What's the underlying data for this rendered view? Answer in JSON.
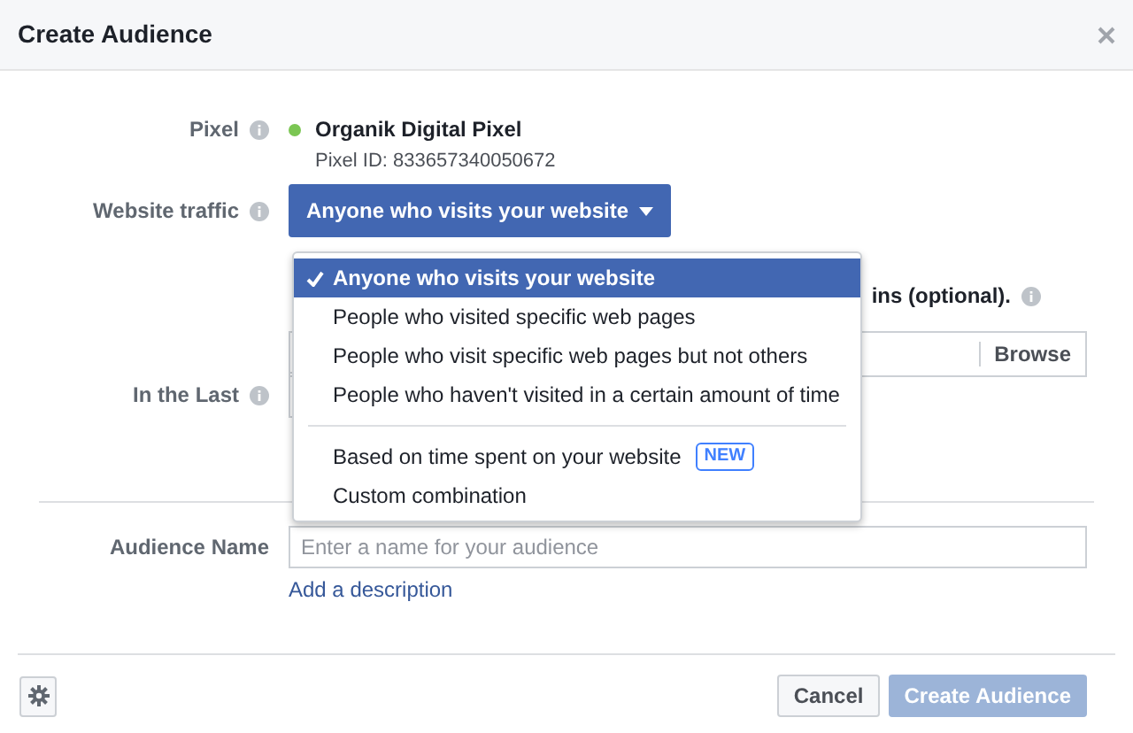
{
  "dialog": {
    "title": "Create Audience"
  },
  "pixel": {
    "label": "Pixel",
    "name": "Organik Digital Pixel",
    "id_text": "Pixel ID: 833657340050672"
  },
  "website_traffic": {
    "label": "Website traffic",
    "button": "Anyone who visits your website"
  },
  "menu": {
    "groups": [
      [
        {
          "label": "Anyone who visits your website",
          "selected": true
        },
        {
          "label": "People who visited specific web pages",
          "selected": false
        },
        {
          "label": "People who visit specific web pages but not others",
          "selected": false
        },
        {
          "label": "People who haven't visited in a certain amount of time",
          "selected": false
        }
      ],
      [
        {
          "label": "Based on time spent on your website",
          "selected": false,
          "badge": "NEW"
        },
        {
          "label": "Custom combination",
          "selected": false
        }
      ]
    ]
  },
  "url_section": {
    "label_fragment": "ins (optional).",
    "button": "Browse"
  },
  "in_the_last": {
    "label": "In the Last"
  },
  "audience_name": {
    "label": "Audience Name",
    "placeholder": "Enter a name for your audience",
    "link": "Add a description"
  },
  "footer": {
    "buttons": [
      {
        "label": "Cancel",
        "kind": "secondary",
        "disabled": false
      },
      {
        "label": "Create Audience",
        "kind": "primary",
        "disabled": true
      }
    ]
  }
}
